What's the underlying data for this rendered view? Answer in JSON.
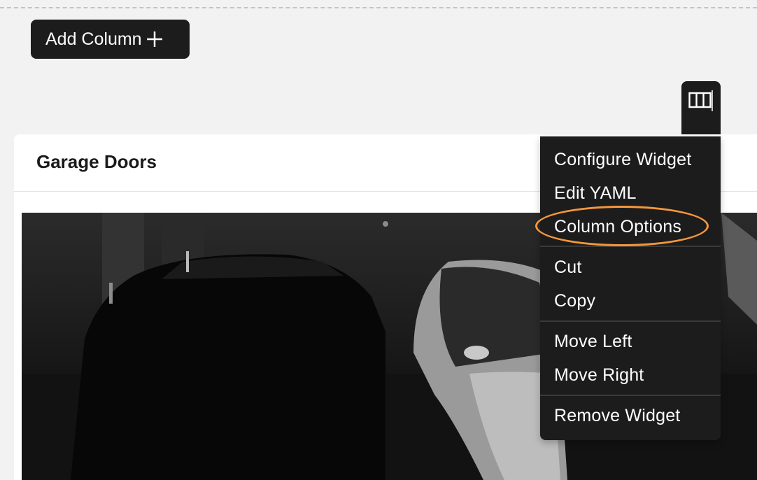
{
  "toolbar": {
    "add_column_label": "Add Column",
    "add_column_icon": "plus-icon"
  },
  "column_tab": {
    "icon": "columns-icon"
  },
  "widget": {
    "title": "Garage Doors",
    "content": "camera-feed"
  },
  "context_menu": {
    "items": [
      {
        "label": "Configure Widget"
      },
      {
        "label": "Edit YAML"
      },
      {
        "label": "Column Options"
      },
      {
        "label": "Cut"
      },
      {
        "label": "Copy"
      },
      {
        "label": "Move Left"
      },
      {
        "label": "Move Right"
      },
      {
        "label": "Remove Widget"
      }
    ],
    "highlighted_item": "Column Options"
  },
  "colors": {
    "background": "#f2f2f2",
    "dark_surface": "#1c1c1c",
    "highlight": "#f5973a",
    "card": "#ffffff"
  }
}
